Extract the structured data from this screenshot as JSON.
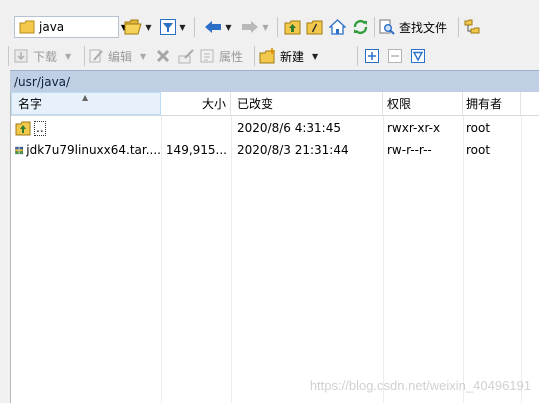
{
  "toolbar": {
    "location_value": "java",
    "find_files_label": "查找文件"
  },
  "toolbar2": {
    "download_label": "下载",
    "edit_label": "编辑",
    "properties_label": "属性",
    "new_label": "新建"
  },
  "path": "/usr/java/",
  "columns": {
    "name": "名字",
    "size": "大小",
    "modified": "已改变",
    "permissions": "权限",
    "owner": "拥有者"
  },
  "files": [
    {
      "name": "..",
      "size": "",
      "modified": "2020/8/6 4:31:45",
      "permissions": "rwxr-xr-x",
      "owner": "root",
      "icon": "parent-folder-icon"
    },
    {
      "name": "jdk7u79linuxx64.tar....",
      "size": "149,915...",
      "modified": "2020/8/3 21:31:44",
      "permissions": "rw-r--r--",
      "owner": "root",
      "icon": "archive-icon"
    }
  ],
  "watermark": "https://blog.csdn.net/weixin_40496191",
  "colors": {
    "pathbar_bg": "#c0cfe4",
    "folder_yellow": "#f2c94c",
    "nav_blue": "#2b6fc9",
    "refresh_green": "#2e9e3a"
  }
}
